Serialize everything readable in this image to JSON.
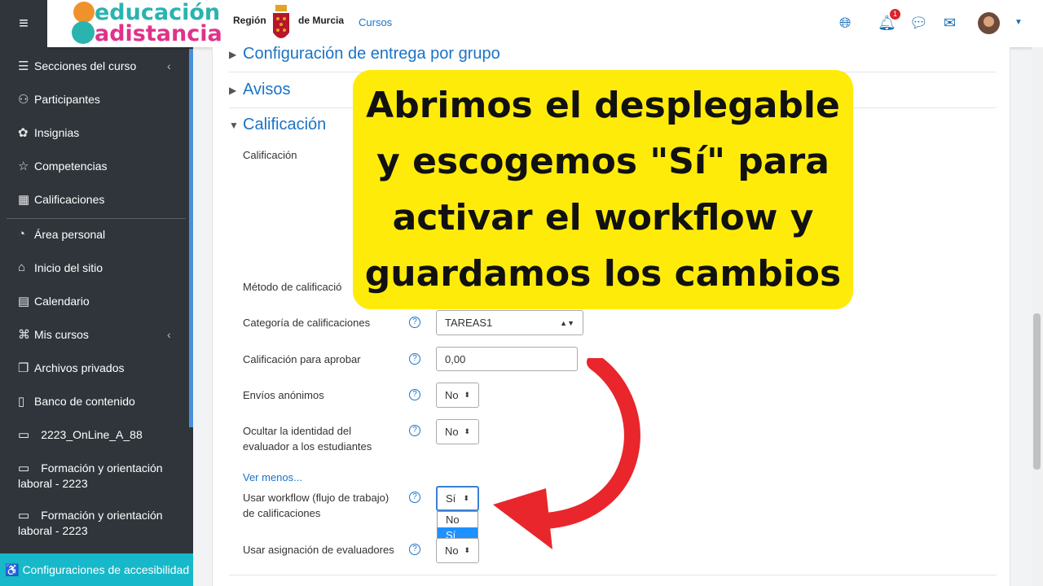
{
  "sidebar": {
    "menu_icon": "hamburger-icon",
    "items": [
      {
        "label": "Secciones del curso",
        "icon": "list-icon",
        "chevron": "‹"
      },
      {
        "label": "Participantes",
        "icon": "users-icon"
      },
      {
        "label": "Insignias",
        "icon": "badge-icon"
      },
      {
        "label": "Competencias",
        "icon": "star-icon"
      },
      {
        "label": "Calificaciones",
        "icon": "grades-icon"
      },
      {
        "label": "Área personal",
        "icon": "dashboard-icon"
      },
      {
        "label": "Inicio del sitio",
        "icon": "home-icon"
      },
      {
        "label": "Calendario",
        "icon": "calendar-icon"
      },
      {
        "label": "Mis cursos",
        "icon": "graduation-icon",
        "chevron": "‹"
      },
      {
        "label": "Archivos privados",
        "icon": "files-icon"
      },
      {
        "label": "Banco de contenido",
        "icon": "clipboard-icon"
      }
    ],
    "folders": [
      {
        "label": "2223_OnLine_A_88"
      },
      {
        "label": "Formación y orientación laboral - 2223"
      },
      {
        "label": "Formación y orientación laboral - 2223"
      }
    ],
    "accessibility": "Configuraciones de accesibilidad"
  },
  "topbar": {
    "logo_line1": "educación",
    "logo_line2": "adistancia",
    "logo_e": "e",
    "logo_a": "a",
    "region": "Región",
    "murcia": "de Murcia",
    "cursos": "Cursos",
    "notification_count": "1"
  },
  "main": {
    "sections": [
      {
        "title": "Configuración de entrega por grupo",
        "expanded": false
      },
      {
        "title": "Avisos",
        "expanded": false
      },
      {
        "title": "Calificación",
        "expanded": true
      }
    ],
    "fields": {
      "calificacion_label": "Calificación",
      "metodo_label": "Método de calificació",
      "categoria_label": "Categoría de calificaciones",
      "categoria_value": "TAREAS1",
      "aprobar_label": "Calificación para aprobar",
      "aprobar_value": "0,00",
      "anonimos_label": "Envíos anónimos",
      "anonimos_value": "No",
      "ocultar_label_1": "Ocultar la identidad del",
      "ocultar_label_2": "evaluador a los estudiantes",
      "ocultar_value": "No",
      "ver_menos": "Ver menos...",
      "workflow_label_1": "Usar workflow (flujo de trabajo)",
      "workflow_label_2": "de calificaciones",
      "workflow_value": "Sí",
      "workflow_options": [
        "No",
        "Sí"
      ],
      "evaluadores_label": "Usar asignación de evaluadores",
      "evaluadores_value": "No"
    }
  },
  "annotation": {
    "lines": [
      "Abrimos el desplegable",
      "y escogemos \"Sí\" para",
      "activar el workflow y",
      "guardamos los cambios"
    ],
    "highlight_color": "#ffeb0a",
    "arrow_color": "#e8262b"
  }
}
